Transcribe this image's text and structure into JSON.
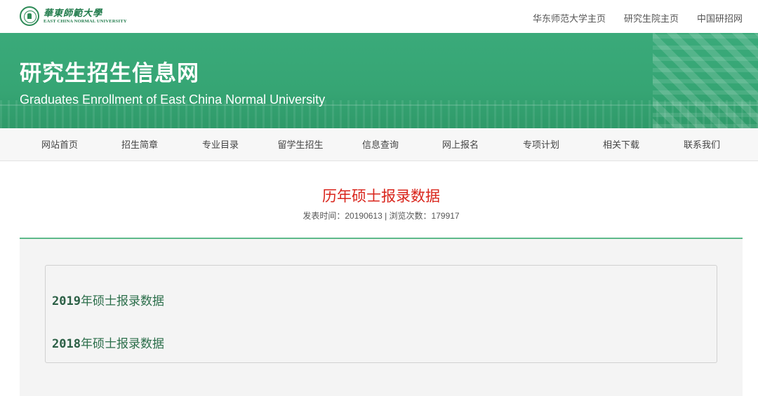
{
  "header": {
    "logo": {
      "cn_text": "華東師範大學",
      "en_text": "EAST CHINA NORMAL UNIVERSITY"
    },
    "top_links": [
      {
        "label": "华东师范大学主页"
      },
      {
        "label": "研究生院主页"
      },
      {
        "label": "中国研招网"
      }
    ]
  },
  "banner": {
    "title": "研究生招生信息网",
    "subtitle": "Graduates Enrollment of East China Normal University"
  },
  "nav": {
    "items": [
      {
        "label": "网站首页"
      },
      {
        "label": "招生简章"
      },
      {
        "label": "专业目录"
      },
      {
        "label": "留学生招生"
      },
      {
        "label": "信息查询"
      },
      {
        "label": "网上报名"
      },
      {
        "label": "专项计划"
      },
      {
        "label": "相关下载"
      },
      {
        "label": "联系我们"
      }
    ]
  },
  "article": {
    "title": "历年硕士报录数据",
    "meta": "发表时间：20190613 | 浏览次数：179917",
    "links": [
      {
        "year": "2019",
        "label": "年硕士报录数据"
      },
      {
        "year": "2018",
        "label": "年硕士报录数据"
      }
    ]
  },
  "colors": {
    "banner_green": "#36a574",
    "title_red": "#d9251c",
    "rule_green": "#5db98a",
    "link_green": "#2b6e4a"
  }
}
